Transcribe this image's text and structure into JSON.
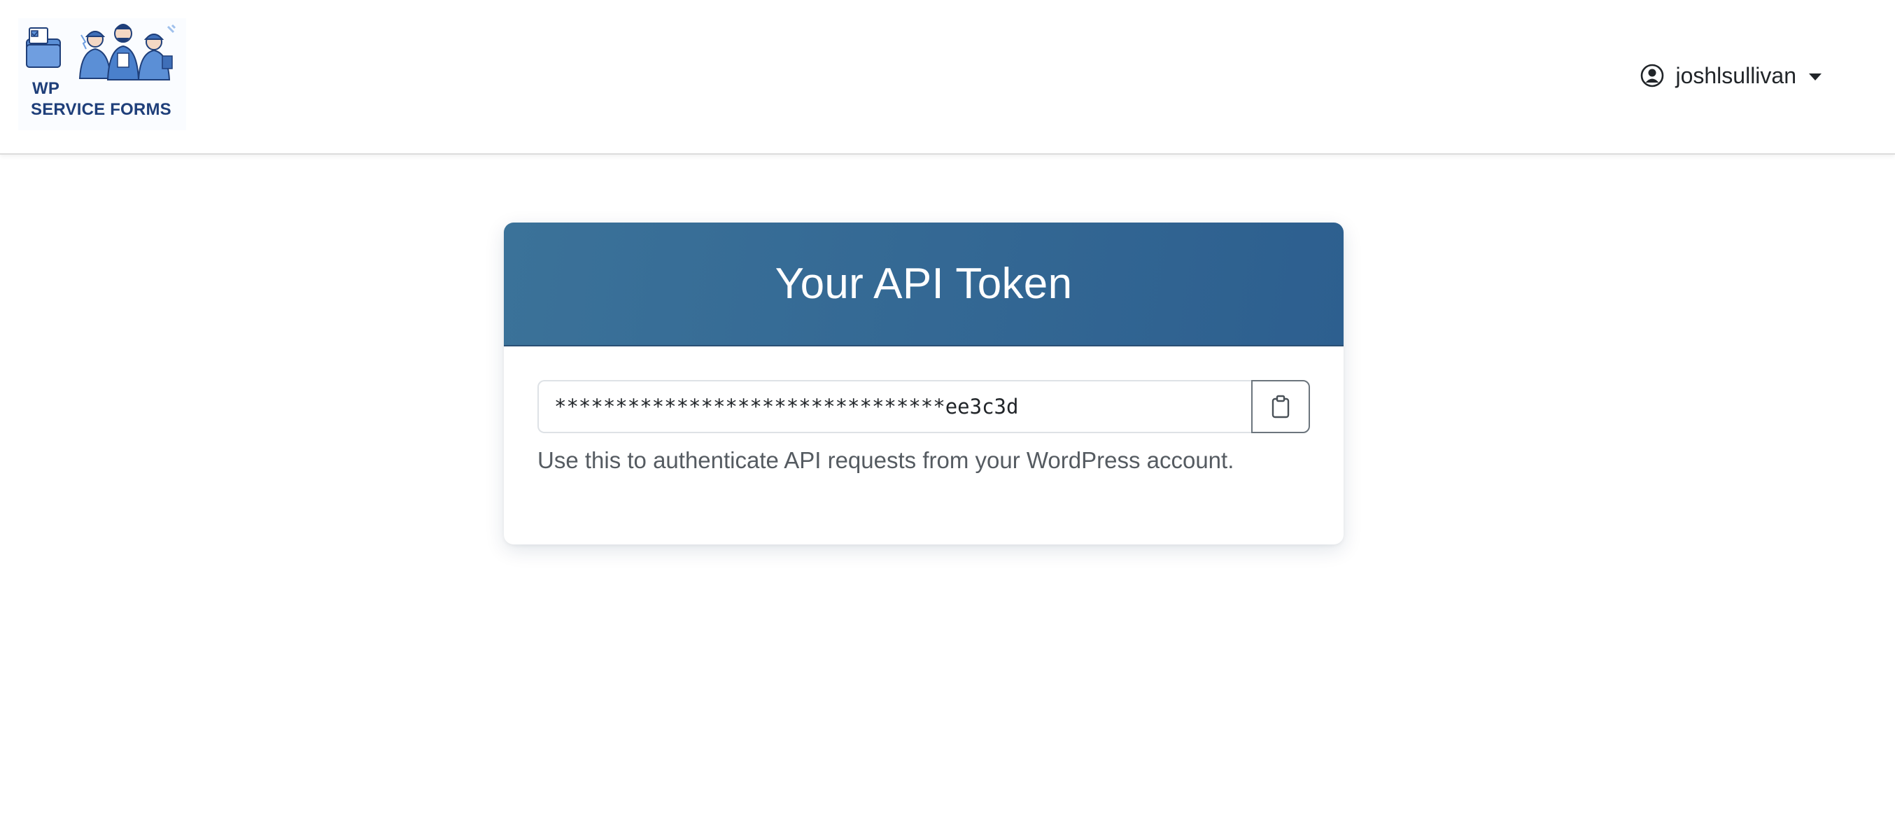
{
  "header": {
    "brand": {
      "line1": "WP",
      "line2": "SERVICE FORMS",
      "logo_icon": "form-folder-and-technicians-logo"
    },
    "user_menu": {
      "username": "joshlsullivan",
      "icon": "user-circle-icon",
      "dropdown_icon": "caret-down-icon"
    }
  },
  "card": {
    "title": "Your API Token",
    "token_value": "********************************ee3c3d",
    "copy_icon": "clipboard-icon",
    "help_text": "Use this to authenticate API requests from your WordPress account."
  },
  "colors": {
    "header_gradient_start": "#3b7299",
    "header_gradient_end": "#2d5f8f",
    "brand_text": "#1f3f7a"
  }
}
